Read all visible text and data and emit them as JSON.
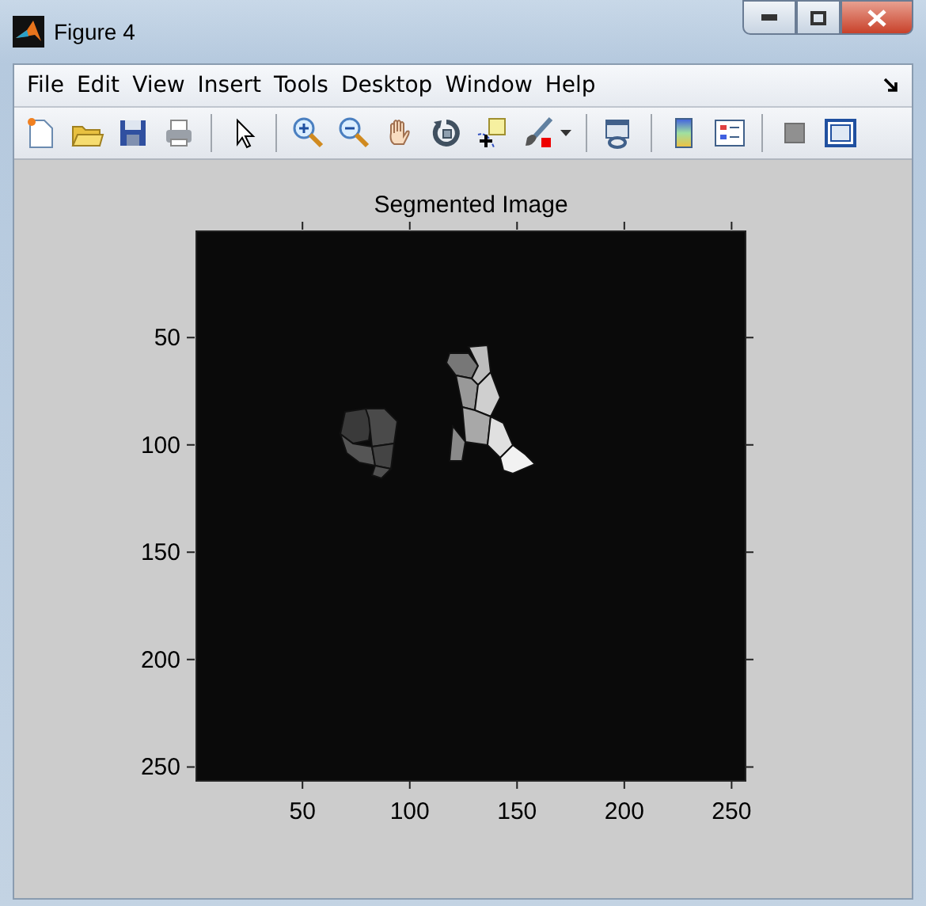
{
  "window": {
    "title": "Figure 4"
  },
  "menu": [
    "File",
    "Edit",
    "View",
    "Insert",
    "Tools",
    "Desktop",
    "Window",
    "Help"
  ],
  "axes": {
    "title": "Segmented Image",
    "x_ticks": [
      "50",
      "100",
      "150",
      "200",
      "250"
    ],
    "y_ticks": [
      "50",
      "100",
      "150",
      "200",
      "250"
    ]
  }
}
